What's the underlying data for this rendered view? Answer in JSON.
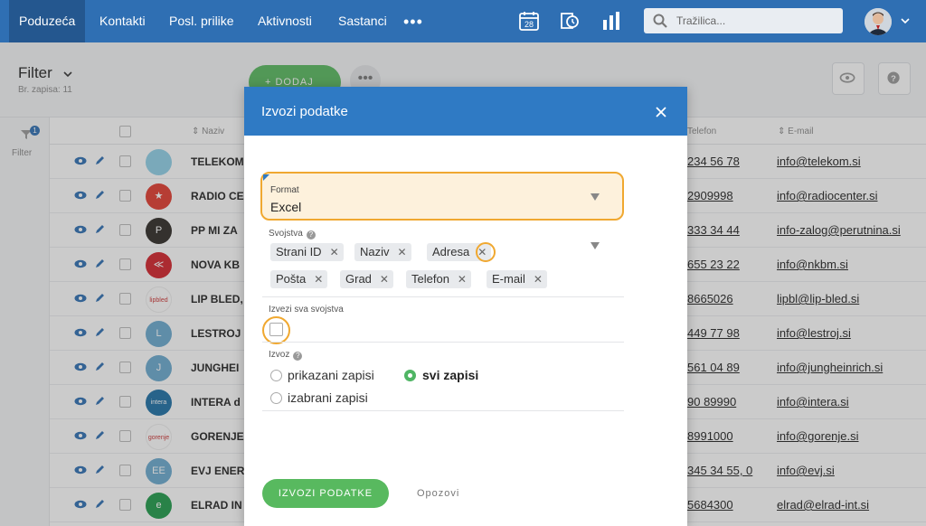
{
  "nav": {
    "items": [
      "Poduzeća",
      "Kontakti",
      "Posl. prilike",
      "Aktivnosti",
      "Sastanci"
    ],
    "more": "•••",
    "calendar_day": "28",
    "search_placeholder": "Tražilica..."
  },
  "header": {
    "title": "Filter",
    "record_count": "Br. zapisa: 11",
    "add_label": "+ DODAJ",
    "more_label": "•••"
  },
  "rail": {
    "filter_badge": "1",
    "filter_label": "Filter"
  },
  "table": {
    "columns": {
      "name": "Naziv",
      "phone": "Telefon",
      "email": "E-mail"
    },
    "rows": [
      {
        "name": "TELEKOM",
        "phone": "234 56 78",
        "email": "info@telekom.si",
        "logo_bg": "#8fd0e8",
        "logo_text": ""
      },
      {
        "name": "RADIO CE",
        "phone": "2909998",
        "email": "info@radiocenter.si",
        "logo_bg": "#e23b2e",
        "logo_text": "★"
      },
      {
        "name": "PP MI ZA",
        "phone": "333 34 44",
        "email": "info-zalog@perutnina.si",
        "logo_bg": "#2e2a26",
        "logo_text": "P"
      },
      {
        "name": "NOVA KB",
        "phone": "655 23 22",
        "email": "info@nkbm.si",
        "logo_bg": "#d3222a",
        "logo_text": "≪"
      },
      {
        "name": "LIP BLED,",
        "phone": "8665026",
        "email": "lipbl@lip-bled.si",
        "logo_bg": "#ffffff",
        "logo_text": "lipbled"
      },
      {
        "name": "LESTROJ",
        "phone": "449 77 98",
        "email": "info@lestroj.si",
        "logo_bg": "#6aa9cf",
        "logo_text": "L"
      },
      {
        "name": "JUNGHEI",
        "phone": "561 04 89",
        "email": "info@jungheinrich.si",
        "logo_bg": "#6aa9cf",
        "logo_text": "J"
      },
      {
        "name": "INTERA d",
        "phone": "90 89990",
        "email": "info@intera.si",
        "logo_bg": "#1d6fa5",
        "logo_text": "intera"
      },
      {
        "name": "GORENJE",
        "phone": "8991000",
        "email": "info@gorenje.si",
        "logo_bg": "#ffffff",
        "logo_text": "gorenje"
      },
      {
        "name": "EVJ ENER",
        "phone": "345 34 55, 0",
        "email": "info@evj.si",
        "logo_bg": "#6aa9cf",
        "logo_text": "EE"
      },
      {
        "name": "ELRAD IN",
        "phone": "5684300",
        "email": "elrad@elrad-int.si",
        "logo_bg": "#1f9a4a",
        "logo_text": "e"
      }
    ]
  },
  "modal": {
    "title": "Izvozi podatke",
    "format": {
      "label": "Format",
      "value": "Excel"
    },
    "properties": {
      "label": "Svojstva",
      "chips": [
        "Strani ID",
        "Naziv",
        "Adresa",
        "Pošta",
        "Grad",
        "Telefon",
        "E-mail"
      ]
    },
    "export_all": {
      "label": "Izvezi sva svojstva"
    },
    "export": {
      "label": "Izvoz",
      "options": [
        "prikazani zapisi",
        "svi zapisi",
        "izabrani zapisi"
      ],
      "selected": "svi zapisi"
    },
    "submit_label": "IZVOZI PODATKE",
    "cancel_label": "Opozovi"
  },
  "colors": {
    "nav": "#2f6fb3",
    "modal_header": "#2f7ac4",
    "green": "#58b95f",
    "highlight": "#f0a830"
  }
}
